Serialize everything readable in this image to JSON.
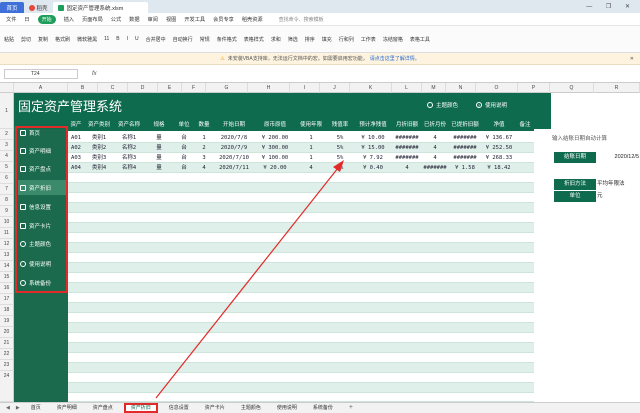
{
  "titlebar": {
    "home_tab": "首页",
    "wps_tab": "稻壳",
    "file_tab": "固定资产管理系统.xlsm",
    "window_controls": "— ❐ ✕"
  },
  "menu": {
    "items": [
      "文件",
      "日",
      "开始",
      "插入",
      "页面布局",
      "公式",
      "数据",
      "审阅",
      "视图",
      "开发工具",
      "会员专享",
      "稻壳资源"
    ],
    "search": "查找命令、搜索模板"
  },
  "ribbon": {
    "items": [
      "粘贴",
      "剪切",
      "复制",
      "格式刷",
      "微软雅黑",
      "11",
      "B",
      "I",
      "U",
      "合并居中",
      "自动换行",
      "常规",
      "条件格式",
      "表格样式",
      "求和",
      "筛选",
      "排序",
      "填充",
      "行和列",
      "工作表",
      "冻结窗格",
      "表格工具"
    ]
  },
  "warning": {
    "text": "未安装VBA支持库，无法运行文档中的宏。如需要启用宏功能，",
    "link": "请点击这里了解详情。"
  },
  "formula": {
    "cell_ref": "T24",
    "fx": "fx"
  },
  "columns": [
    "A",
    "B",
    "C",
    "D",
    "E",
    "F",
    "G",
    "H",
    "I",
    "J",
    "K",
    "L",
    "M",
    "N",
    "O",
    "P",
    "Q",
    "R"
  ],
  "rows": [
    "1",
    "2",
    "3",
    "4",
    "5",
    "6",
    "7",
    "8",
    "9",
    "10",
    "11",
    "12",
    "13",
    "14",
    "15",
    "16",
    "17",
    "18",
    "19",
    "20",
    "21",
    "22",
    "23",
    "24"
  ],
  "app": {
    "title": "固定资产管理系统",
    "color_link": "主题颜色",
    "help_link": "使用说明"
  },
  "sidebar": {
    "items": [
      {
        "label": "首页",
        "icon": "home-icon"
      },
      {
        "label": "资产明细",
        "icon": "list-icon"
      },
      {
        "label": "资产盘点",
        "icon": "clipboard-icon"
      },
      {
        "label": "资产折旧",
        "icon": "chart-icon"
      },
      {
        "label": "信息设置",
        "icon": "settings-icon"
      },
      {
        "label": "资产卡片",
        "icon": "card-icon"
      },
      {
        "label": "主题颜色",
        "icon": "palette-icon"
      },
      {
        "label": "使用说明",
        "icon": "help-icon"
      },
      {
        "label": "系统备份",
        "icon": "backup-icon"
      }
    ]
  },
  "table": {
    "headers": [
      "资产编号",
      "资产类别",
      "资产名称",
      "规格",
      "单位",
      "数量",
      "开始日期",
      "原币原值",
      "使用年限",
      "残值率",
      "预计净残值",
      "月折旧额",
      "已折月份",
      "已提折旧额",
      "净值",
      "备注"
    ],
    "rows": [
      [
        "A01",
        "类别1",
        "名称1",
        "量",
        "台",
        "1",
        "2020/7/8",
        "¥ 200.00",
        "1",
        "5%",
        "¥ 10.00",
        "#######",
        "4",
        "#######",
        "¥ 136.67",
        ""
      ],
      [
        "A02",
        "类别2",
        "名称2",
        "量",
        "台",
        "2",
        "2020/7/9",
        "¥ 300.00",
        "1",
        "5%",
        "¥ 15.00",
        "#######",
        "4",
        "#######",
        "¥ 252.50",
        ""
      ],
      [
        "A03",
        "类别3",
        "名称3",
        "量",
        "台",
        "3",
        "2020/7/10",
        "¥ 100.00",
        "1",
        "5%",
        "¥ 7.92",
        "#######",
        "4",
        "#######",
        "¥ 268.33",
        ""
      ],
      [
        "A04",
        "类别4",
        "名称4",
        "量",
        "台",
        "4",
        "2020/7/11",
        "¥ 20.00",
        "4",
        "5%",
        "¥ 0.40",
        "4",
        "#######",
        "¥ 1.58",
        "¥ 18.42",
        ""
      ]
    ]
  },
  "right_panel": {
    "note": "输入结账日期自动计算",
    "settle_label": "结账日期",
    "settle_value": "2020/12/5",
    "method_label": "折旧方法",
    "method_value": "平均年限法",
    "unit_label": "单位",
    "unit_value": "元"
  },
  "sheet_tabs": {
    "tabs": [
      "首页",
      "资产明细",
      "资产盘点",
      "资产折旧",
      "信息设置",
      "资产卡片",
      "主题颜色",
      "使用说明",
      "系统备份"
    ],
    "active": "资产折旧",
    "plus": "+"
  },
  "colors": {
    "brand_green": "#0f6b4e",
    "highlight_red": "#e12b2b",
    "stripe": "#dff0ea"
  }
}
